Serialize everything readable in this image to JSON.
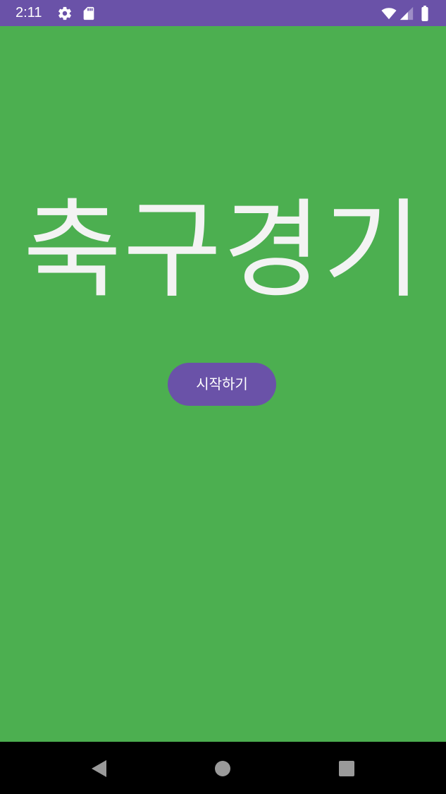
{
  "status_bar": {
    "time": "2:11",
    "icons": [
      "gear-icon",
      "sd-card-icon",
      "wifi-icon",
      "cellular-signal-icon",
      "battery-icon"
    ],
    "color": "#6a52a8"
  },
  "main": {
    "title": "축구경기",
    "start_button_label": "시작하기",
    "background_color": "#4caf50",
    "title_color": "#f3f3f3",
    "button_color": "#6a52a8"
  },
  "nav_bar": {
    "buttons": [
      "back-icon",
      "home-icon",
      "recents-icon"
    ]
  }
}
